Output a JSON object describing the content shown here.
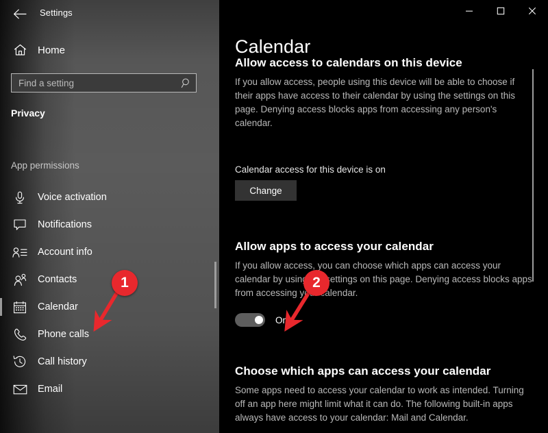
{
  "window": {
    "title": "Settings",
    "back_icon": "back-arrow-icon",
    "controls": {
      "minimize": "minimize-icon",
      "maximize": "maximize-icon",
      "close": "close-icon"
    }
  },
  "sidebar": {
    "home": {
      "label": "Home",
      "icon": "home-icon"
    },
    "search": {
      "placeholder": "Find a setting",
      "value": "",
      "icon": "search-icon"
    },
    "category": "Privacy",
    "group_header": "App permissions",
    "items": [
      {
        "label": "Voice activation",
        "icon": "microphone-icon",
        "selected": false
      },
      {
        "label": "Notifications",
        "icon": "speech-bubble-icon",
        "selected": false
      },
      {
        "label": "Account info",
        "icon": "account-info-icon",
        "selected": false
      },
      {
        "label": "Contacts",
        "icon": "contacts-icon",
        "selected": false
      },
      {
        "label": "Calendar",
        "icon": "calendar-icon",
        "selected": true
      },
      {
        "label": "Phone calls",
        "icon": "phone-icon",
        "selected": false
      },
      {
        "label": "Call history",
        "icon": "call-history-icon",
        "selected": false
      },
      {
        "label": "Email",
        "icon": "envelope-icon",
        "selected": false
      }
    ]
  },
  "main": {
    "page_title": "Calendar",
    "sections": [
      {
        "heading": "Allow access to calendars on this device",
        "body": "If you allow access, people using this device will be able to choose if their apps have access to their calendar by using the settings on this page. Denying access blocks apps from accessing any person's calendar.",
        "status": "Calendar access for this device is on",
        "button": "Change"
      },
      {
        "heading": "Allow apps to access your calendar",
        "body": "If you allow access, you can choose which apps can access your calendar by using the settings on this page. Denying access blocks apps from accessing your calendar.",
        "toggle_state": "On"
      },
      {
        "heading": "Choose which apps can access your calendar",
        "body": "Some apps need to access your calendar to work as intended. Turning off an app here might limit what it can do. The following built-in apps always have access to your calendar: Mail and Calendar."
      }
    ]
  },
  "annotations": {
    "accent_color": "#e8282d",
    "badges": [
      {
        "label": "1"
      },
      {
        "label": "2"
      }
    ]
  }
}
